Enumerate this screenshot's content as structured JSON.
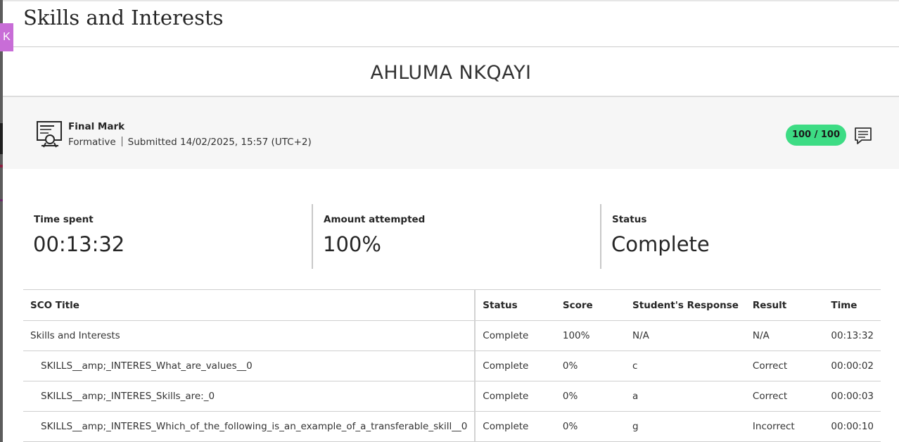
{
  "page": {
    "title": "Skills and Interests",
    "student_name": "AHLUMA NKQAYI",
    "collapse_glyph": "K"
  },
  "grade": {
    "title": "Final Mark",
    "type": "Formative",
    "submitted": "Submitted 14/02/2025, 15:57 (UTC+2)",
    "score": "100 / 100",
    "icons": {
      "grade": "certificate-icon",
      "feedback": "feedback-icon"
    },
    "pill_color": "#3ddc84"
  },
  "stats": [
    {
      "label": "Time spent",
      "value": "00:13:32"
    },
    {
      "label": "Amount attempted",
      "value": "100%"
    },
    {
      "label": "Status",
      "value": "Complete"
    }
  ],
  "table": {
    "headers": [
      "SCO Title",
      "Status",
      "Score",
      "Student's Response",
      "Result",
      "Time"
    ],
    "rows": [
      {
        "title": "Skills and Interests",
        "status": "Complete",
        "score": "100%",
        "response": "N/A",
        "result": "N/A",
        "time": "00:13:32"
      },
      {
        "title": "SKILLS__amp;_INTERES_What_are_values__0",
        "status": "Complete",
        "score": "0%",
        "response": "c",
        "result": "Correct",
        "time": "00:00:02"
      },
      {
        "title": "SKILLS__amp;_INTERES_Skills_are:_0",
        "status": "Complete",
        "score": "0%",
        "response": "a",
        "result": "Correct",
        "time": "00:00:03"
      },
      {
        "title": "SKILLS__amp;_INTERES_Which_of_the_following_is_an_example_of_a_transferable_skill__0",
        "status": "Complete",
        "score": "0%",
        "response": "g",
        "result": "Incorrect",
        "time": "00:00:10"
      }
    ]
  },
  "colors": {
    "accent": "#c86dd7",
    "success": "#3ddc84"
  }
}
